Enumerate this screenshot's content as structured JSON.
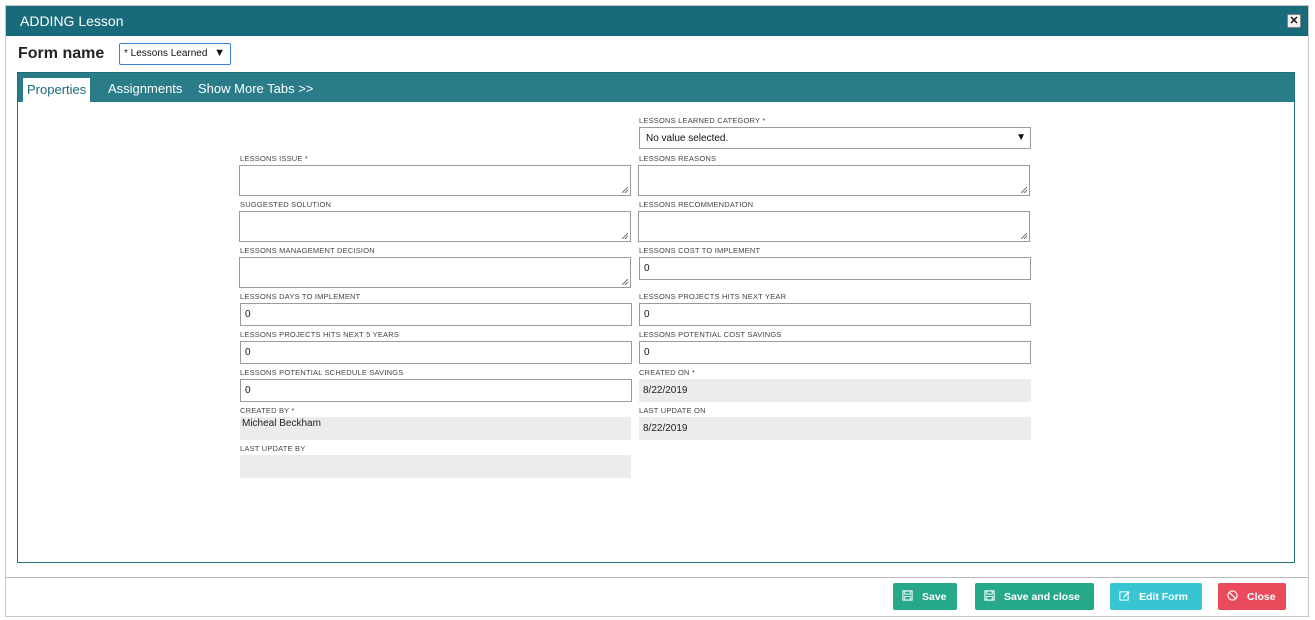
{
  "dialog": {
    "title": "ADDING Lesson",
    "close_icon": "close-icon"
  },
  "form_name": {
    "label": "Form name",
    "selected": "* Lessons Learned"
  },
  "tabs": [
    {
      "label": "Properties",
      "active": true
    },
    {
      "label": "Assignments",
      "active": false
    },
    {
      "label": "Show More Tabs >>",
      "active": false
    }
  ],
  "fields": {
    "category": {
      "label": "LESSONS LEARNED CATEGORY *",
      "value": "No value selected."
    },
    "issue": {
      "label": "LESSONS ISSUE *",
      "value": ""
    },
    "reasons": {
      "label": "LESSONS REASONS",
      "value": ""
    },
    "solution": {
      "label": "SUGGESTED SOLUTION",
      "value": ""
    },
    "recommendation": {
      "label": "LESSONS RECOMMENDATION",
      "value": ""
    },
    "mgmt_decision": {
      "label": "LESSONS MANAGEMENT DECISION",
      "value": ""
    },
    "cost_to_implement": {
      "label": "LESSONS COST TO IMPLEMENT",
      "value": "0"
    },
    "days_to_implement": {
      "label": "LESSONS DAYS TO IMPLEMENT",
      "value": "0"
    },
    "hits_next_year": {
      "label": "LESSONS PROJECTS HITS NEXT YEAR",
      "value": "0"
    },
    "hits_next_5_years": {
      "label": "LESSONS PROJECTS HITS NEXT 5 YEARS",
      "value": "0"
    },
    "potential_cost_savings": {
      "label": "LESSONS POTENTIAL COST SAVINGS",
      "value": "0"
    },
    "potential_schedule_savings": {
      "label": "LESSONS POTENTIAL SCHEDULE SAVINGS",
      "value": "0"
    },
    "created_on": {
      "label": "CREATED ON *",
      "value": "8/22/2019"
    },
    "created_by": {
      "label": "CREATED BY *",
      "value": "Micheal Beckham"
    },
    "last_update_on": {
      "label": "LAST UPDATE ON",
      "value": "8/22/2019"
    },
    "last_update_by": {
      "label": "LAST UPDATE BY",
      "value": ""
    }
  },
  "buttons": {
    "save": {
      "label": "Save",
      "color": "#26a98b"
    },
    "save_close": {
      "label": "Save and close",
      "color": "#26a98b"
    },
    "edit_form": {
      "label": "Edit Form",
      "color": "#37c6d1"
    },
    "close": {
      "label": "Close",
      "color": "#ea4b5c"
    }
  },
  "colors": {
    "header": "#196b7b",
    "tabbar": "#2a7c89"
  }
}
